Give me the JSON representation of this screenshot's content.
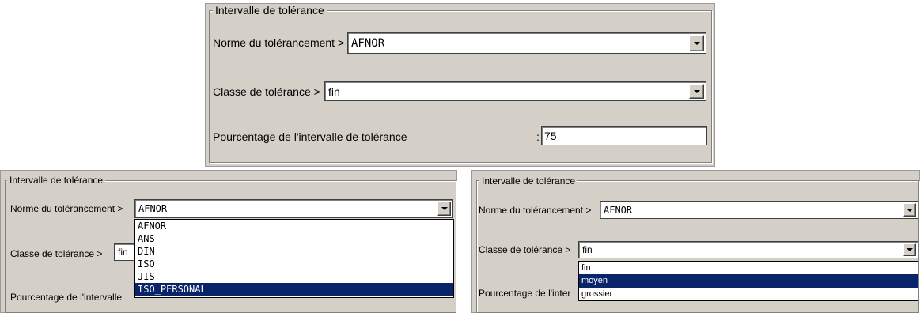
{
  "top": {
    "group_title": "Intervalle de tolérance",
    "norme_label": "Norme du tolérancement >",
    "norme_value": "AFNOR",
    "classe_label": "Classe de tolérance >",
    "classe_value": "fin",
    "pourcentage_label": "Pourcentage de l'intervalle de tolérance",
    "pourcentage_sep": ":",
    "pourcentage_value": "75"
  },
  "bottom_left": {
    "group_title": "Intervalle de tolérance",
    "norme_label": "Norme du tolérancement >",
    "norme_value": "AFNOR",
    "classe_label": "Classe de tolérance >",
    "classe_value": "fin",
    "pourcentage_label": "Pourcentage de l'intervalle",
    "norme_options": [
      "AFNOR",
      "ANS",
      "DIN",
      "ISO",
      "JIS",
      "ISO_PERSONAL"
    ],
    "norme_highlighted": "ISO_PERSONAL"
  },
  "bottom_right": {
    "group_title": "Intervalle de tolérance",
    "norme_label": "Norme du tolérancement >",
    "norme_value": "AFNOR",
    "classe_label": "Classe de tolérance >",
    "classe_value": "fin",
    "pourcentage_label": "Pourcentage de l'inter",
    "classe_options": [
      "fin",
      "moyen",
      "grossier"
    ],
    "classe_highlighted": "moyen"
  },
  "colors": {
    "dialog_bg": "#d4d0c8",
    "selection_bg": "#0a246a"
  }
}
